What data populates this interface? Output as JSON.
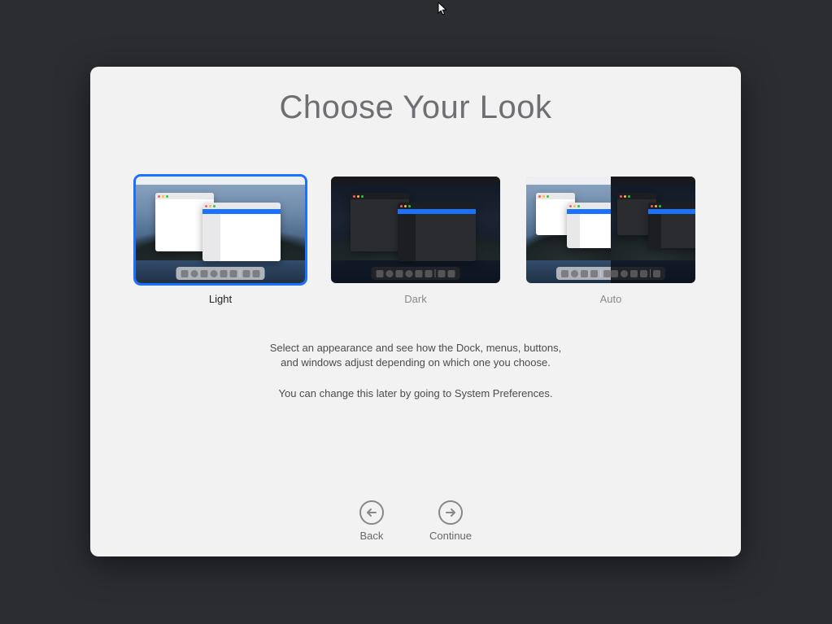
{
  "title": "Choose Your Look",
  "options": {
    "light": {
      "label": "Light"
    },
    "dark": {
      "label": "Dark"
    },
    "auto": {
      "label": "Auto"
    }
  },
  "selected_option": "light",
  "description": {
    "line1": "Select an appearance and see how the Dock, menus, buttons,",
    "line2": "and windows adjust depending on which one you choose.",
    "line3": "You can change this later by going to System Preferences."
  },
  "nav": {
    "back": "Back",
    "continue": "Continue"
  },
  "colors": {
    "accent": "#1a73ff"
  }
}
